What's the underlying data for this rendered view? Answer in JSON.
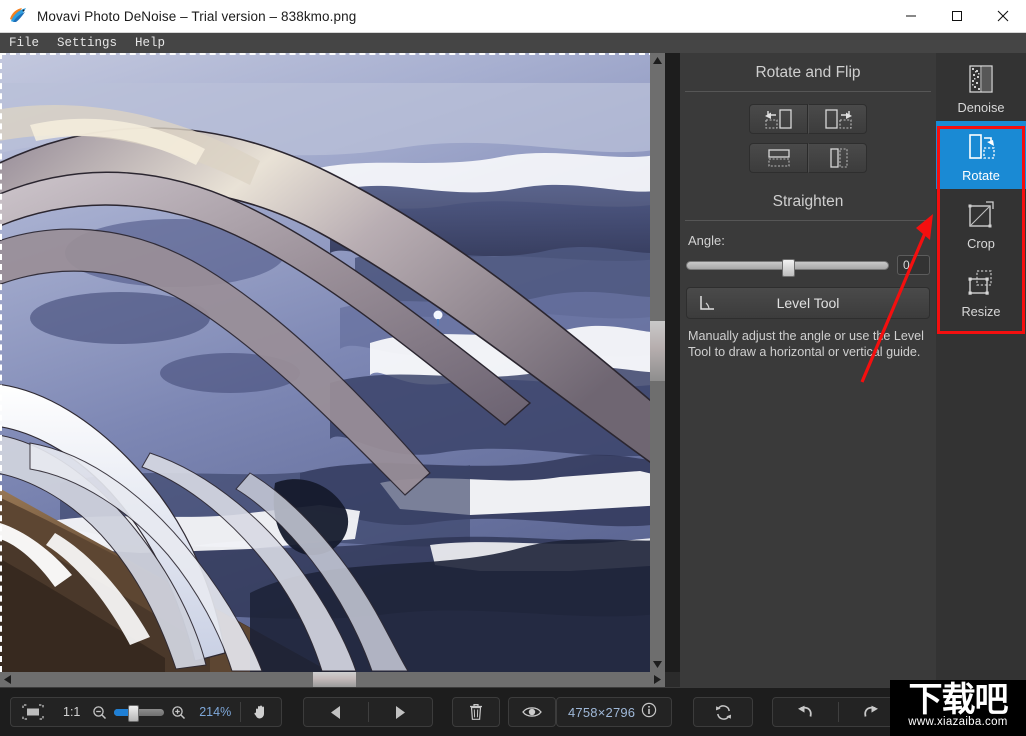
{
  "window": {
    "title": "Movavi Photo DeNoise – Trial version – 838kmo.png",
    "app_icon": "movavi-bird-logo",
    "minimize_label": "–",
    "maximize_label": "□",
    "close_label": "✕"
  },
  "menu": {
    "items": [
      {
        "label": "File",
        "name": "menu-file"
      },
      {
        "label": "Settings",
        "name": "menu-settings"
      },
      {
        "label": "Help",
        "name": "menu-help"
      }
    ]
  },
  "canvas": {
    "image_name": "838kmo.png",
    "selection_marquee": "marching-ants",
    "vertical_scrollbar": {
      "up_arrow": "▲",
      "down_arrow": "▼"
    },
    "horizontal_scrollbar": {
      "left_arrow": "◀",
      "right_arrow": "▶"
    }
  },
  "panel": {
    "section_rotate_flip": "Rotate and Flip",
    "buttons": [
      {
        "label": "",
        "name": "rotate-left-button",
        "icon": "rotate-left-icon"
      },
      {
        "label": "",
        "name": "rotate-right-button",
        "icon": "rotate-right-icon"
      },
      {
        "label": "",
        "name": "flip-vertical-button",
        "icon": "flip-vertical-icon"
      },
      {
        "label": "",
        "name": "flip-horizontal-button",
        "icon": "flip-horizontal-icon"
      }
    ],
    "section_straighten": "Straighten",
    "angle_label": "Angle:",
    "angle_value": "0",
    "level_tool_label": "Level Tool",
    "help_text": "Manually adjust the angle or use the Level Tool to draw a horizontal or vertical guide."
  },
  "rail": {
    "tools": [
      {
        "label": "Denoise",
        "name": "tool-denoise",
        "icon": "denoise-icon",
        "active": false
      },
      {
        "label": "Rotate",
        "name": "tool-rotate",
        "icon": "rotate-icon",
        "active": true
      },
      {
        "label": "Crop",
        "name": "tool-crop",
        "icon": "crop-icon",
        "active": false
      },
      {
        "label": "Resize",
        "name": "tool-resize",
        "icon": "resize-icon",
        "active": false
      }
    ],
    "highlight_color": "#f40f0f",
    "active_color": "#1a8ad4"
  },
  "bottom": {
    "fit_label": "",
    "ratio_label": "1:1",
    "zoom_out_icon": "zoom-out-icon",
    "zoom_in_icon": "zoom-in-icon",
    "zoom_percent": "214%",
    "hand_tool_icon": "hand-icon",
    "prev_icon": "previous-icon",
    "next_icon": "next-icon",
    "delete_icon": "trash-icon",
    "compare_icon": "eye-icon",
    "dimensions": "4758×2796",
    "info_icon": "info-icon",
    "reset_icon": "reset-icon",
    "undo_icon": "undo-icon",
    "redo_icon": "redo-icon"
  },
  "watermark": {
    "logo_text": "下载吧",
    "url_text": "www.xiazaiba.com"
  }
}
